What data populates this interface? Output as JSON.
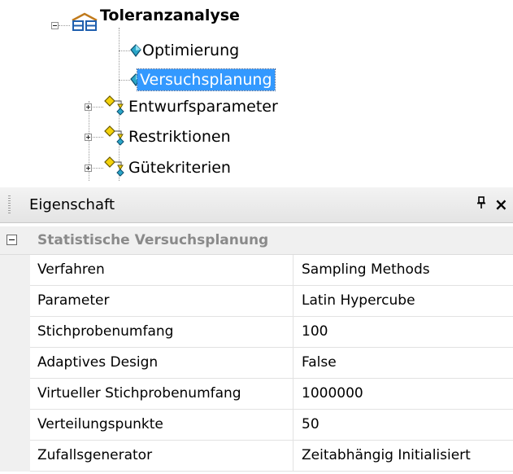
{
  "tree": {
    "root": {
      "label": "Toleranzanalyse",
      "icon": "analysis-group-icon"
    },
    "children": [
      {
        "label": "Optimierung",
        "icon": "diamond-item-icon",
        "selected": false,
        "expandable": false
      },
      {
        "label": "Versuchsplanung",
        "icon": "diamond-item-icon",
        "selected": true,
        "expandable": false
      },
      {
        "label": "Entwurfsparameter",
        "icon": "parameter-group-icon",
        "selected": false,
        "expandable": true
      },
      {
        "label": "Restriktionen",
        "icon": "parameter-group-icon",
        "selected": false,
        "expandable": true
      },
      {
        "label": "Gütekriterien",
        "icon": "parameter-group-icon",
        "selected": false,
        "expandable": true
      }
    ]
  },
  "property_panel": {
    "title": "Eigenschaft",
    "pin_glyph": "ᵖ",
    "close_glyph": "×",
    "category": {
      "label": "Statistische Versuchsplanung",
      "expanded": true
    },
    "properties": [
      {
        "name": "Verfahren",
        "value": "Sampling Methods"
      },
      {
        "name": "Parameter",
        "value": "Latin Hypercube"
      },
      {
        "name": "Stichprobenumfang",
        "value": "100"
      },
      {
        "name": "Adaptives Design",
        "value": "False"
      },
      {
        "name": "Virtueller Stichprobenumfang",
        "value": "1000000"
      },
      {
        "name": "Verteilungspunkte",
        "value": "50"
      },
      {
        "name": "Zufallsgenerator",
        "value": "Zeitabhängig Initialisiert"
      }
    ]
  },
  "colors": {
    "selection": "#3399ff",
    "category_text": "#8a8a8a",
    "icon_blue": "#2aa6c8",
    "icon_yellow": "#f4d20a"
  }
}
